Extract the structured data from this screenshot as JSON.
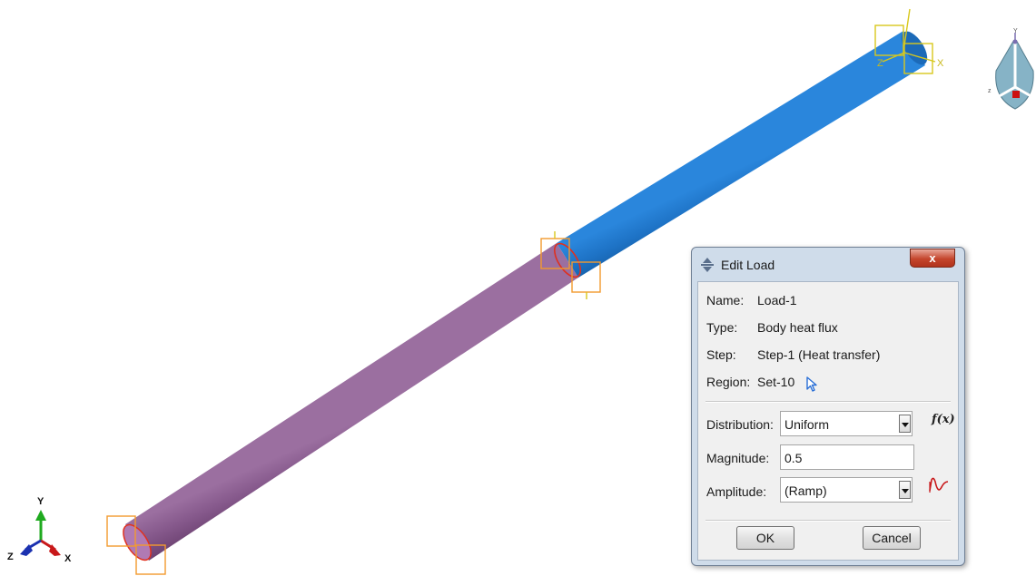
{
  "dialog": {
    "title": "Edit Load",
    "close_label": "x",
    "name_label": "Name:",
    "name_value": "Load-1",
    "type_label": "Type:",
    "type_value": "Body heat flux",
    "step_label": "Step:",
    "step_value": "Step-1 (Heat transfer)",
    "region_label": "Region:",
    "region_value": "Set-10",
    "distribution_label": "Distribution:",
    "distribution_value": "Uniform",
    "fx_label": "f(x)",
    "magnitude_label": "Magnitude:",
    "magnitude_value": "0.5",
    "amplitude_label": "Amplitude:",
    "amplitude_value": "(Ramp)",
    "ok_label": "OK",
    "cancel_label": "Cancel"
  },
  "triad": {
    "y_label": "Y",
    "x_label": "X",
    "z_label": "Z"
  },
  "csys_labels": {
    "x": "X",
    "z": "Z"
  },
  "viewcube": {
    "y_label": "Y",
    "z_label": "z"
  },
  "colors": {
    "rod_loaded": "#8a5a8e",
    "rod_unloaded": "#1f74c8",
    "highlight": "#e0301e",
    "marker_box": "#f39a2e",
    "csys_box": "#d8c81c"
  },
  "icons": [
    "move-icon",
    "close-icon",
    "pick-cursor-icon",
    "function-icon",
    "amplitude-icon",
    "dropdown-arrow-icon",
    "view-orientation-icon",
    "axis-triad-icon"
  ]
}
